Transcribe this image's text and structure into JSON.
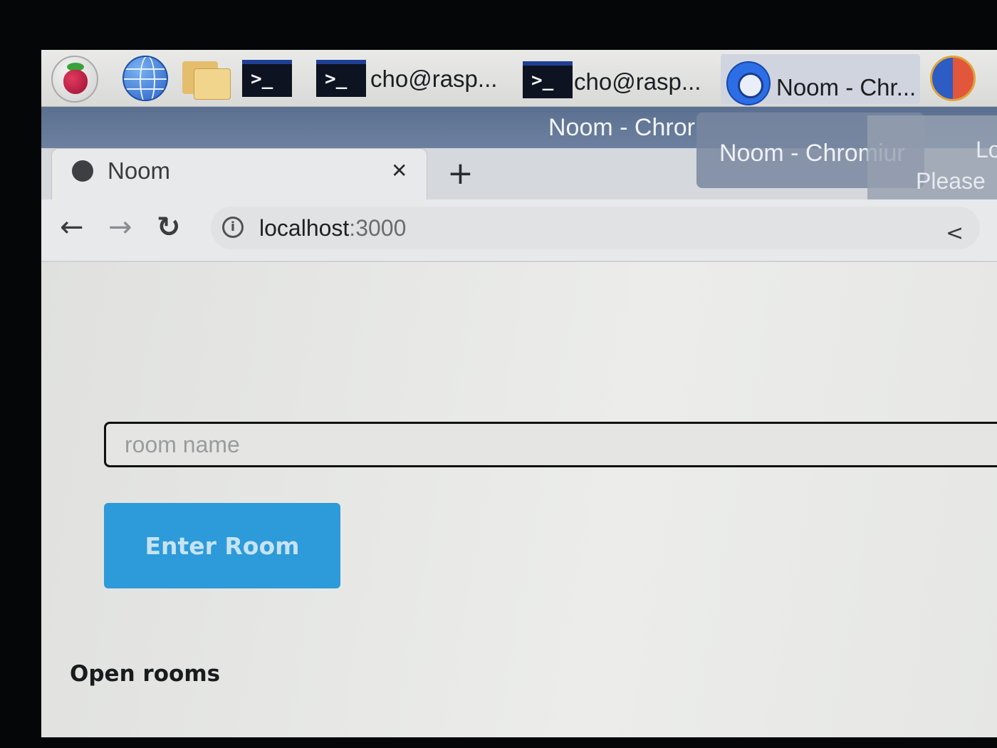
{
  "taskbar": {
    "launchers": [
      {
        "icon": "raspberry-pi-menu-icon"
      },
      {
        "icon": "browser-globe-icon"
      },
      {
        "icon": "file-manager-folder-icon"
      },
      {
        "icon": "terminal-icon",
        "glyph": ">_"
      }
    ],
    "tasks": [
      {
        "icon": "terminal-icon",
        "glyph": ">_",
        "label": "cho@rasp..."
      },
      {
        "icon": "terminal-icon",
        "glyph": ">_",
        "label": "cho@rasp..."
      },
      {
        "icon": "chromium-icon",
        "label": "Noom - Chr..."
      }
    ],
    "tray_icon": "korean-input-icon"
  },
  "window": {
    "title": "Noom - Chromium",
    "title_visible": "Noom - Chror",
    "overlay_title": "Noom - Chromiur",
    "overlay_side_line1": "Lo",
    "overlay_side_line2": "Please"
  },
  "browser": {
    "tab": {
      "label": "Noom",
      "close_glyph": "✕",
      "icon": "globe-icon"
    },
    "new_tab_glyph": "+",
    "nav": {
      "back": "←",
      "forward": "→",
      "reload": "↻"
    },
    "address": {
      "host": "localhost",
      "port": ":3000",
      "icon": "info-icon"
    },
    "share_icon": "share-icon"
  },
  "page": {
    "room_input": {
      "placeholder": "room name",
      "value": ""
    },
    "enter_button": "Enter Room",
    "open_rooms_heading": "Open rooms",
    "rooms": []
  },
  "colors": {
    "button": "#2d9ad9",
    "title_bar": "#5b7090",
    "chrome_task_highlight": "#cfd4de"
  }
}
